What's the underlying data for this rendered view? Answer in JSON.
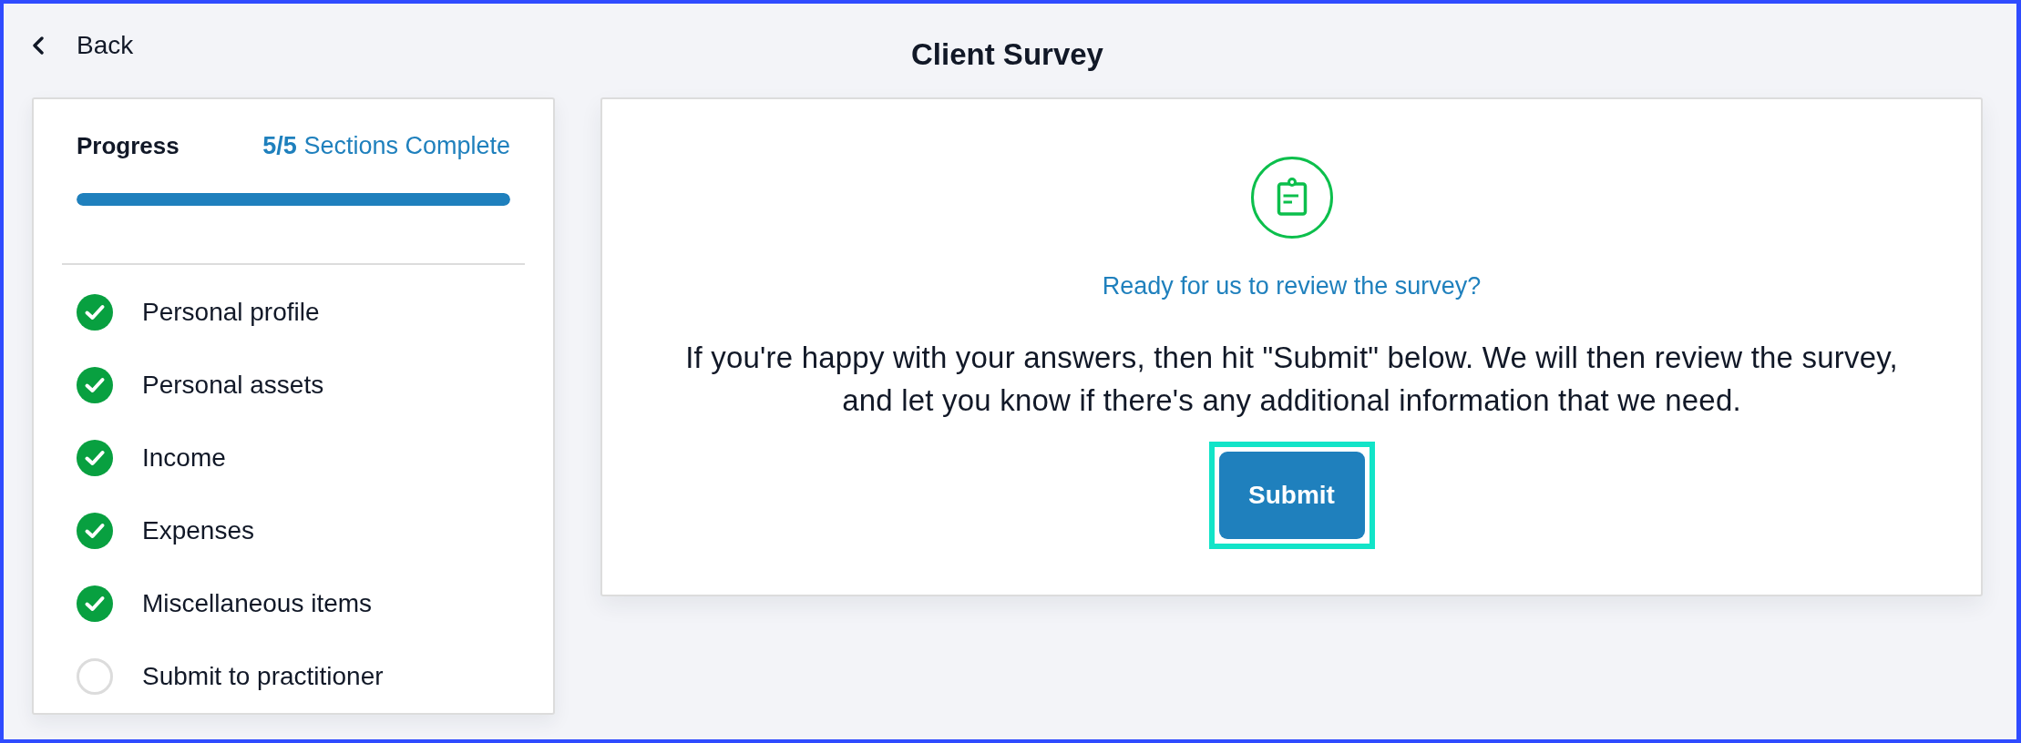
{
  "header": {
    "back_label": "Back",
    "title": "Client Survey"
  },
  "progress": {
    "label": "Progress",
    "summary": "**5/5** Sections Complete",
    "level": 1
  },
  "sections": [
    {
      "label": "Personal profile",
      "completed": true
    },
    {
      "label": "Personal assets",
      "completed": true
    },
    {
      "label": "Income",
      "completed": true
    },
    {
      "label": "Expenses",
      "completed": true
    },
    {
      "label": "Miscellaneous items",
      "completed": true
    },
    {
      "label": "Submit to practitioner",
      "completed": false
    }
  ],
  "review": {
    "heading": "Ready for us to review the survey?",
    "message": "If you're happy with your answers, then hit \"Submit\" below. We will then review the survey, and let you know if there's any additional information that we need.",
    "submit_button": {
      "label": "Submit",
      "focused": true
    }
  }
}
